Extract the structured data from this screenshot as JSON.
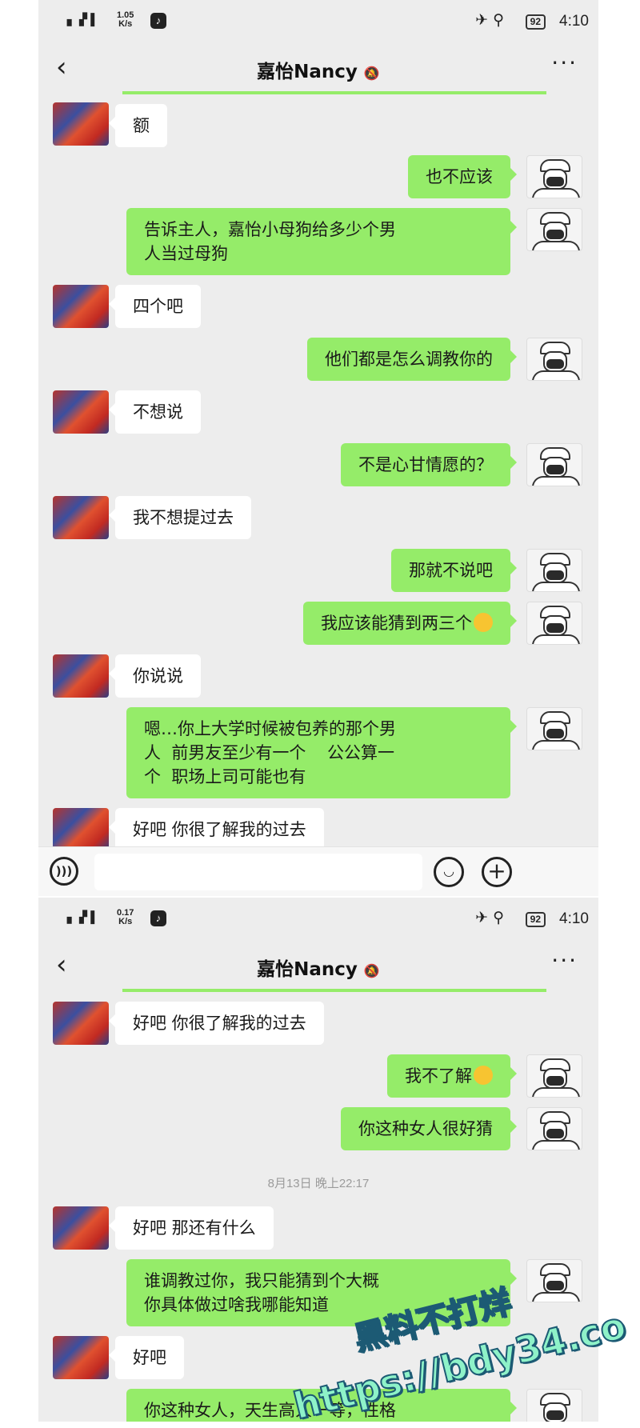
{
  "screens": [
    {
      "status": {
        "signal": "5G",
        "net_speed": "1.05",
        "net_unit": "K/s",
        "battery": "92",
        "time": "4:10"
      },
      "nav": {
        "title": "嘉怡Nancy"
      },
      "messages": [
        {
          "dir": "in",
          "text": "额"
        },
        {
          "dir": "out",
          "text": "也不应该"
        },
        {
          "dir": "out",
          "text": "告诉主人，嘉怡小母狗给多少个男\n人当过母狗"
        },
        {
          "dir": "in",
          "text": "四个吧"
        },
        {
          "dir": "out",
          "text": "他们都是怎么调教你的"
        },
        {
          "dir": "in",
          "text": "不想说"
        },
        {
          "dir": "out",
          "text": "不是心甘情愿的？"
        },
        {
          "dir": "in",
          "text": "我不想提过去"
        },
        {
          "dir": "out",
          "text": "那就不说吧"
        },
        {
          "dir": "out",
          "text": "我应该能猜到两三个",
          "emoji": "thinking-emoji"
        },
        {
          "dir": "in",
          "text": "你说说"
        },
        {
          "dir": "out",
          "text": "嗯…你上大学时候被包养的那个男\n人  前男友至少有一个    公公算一\n个  职场上司可能也有"
        },
        {
          "dir": "in",
          "text": "好吧 你很了解我的过去"
        }
      ]
    },
    {
      "status": {
        "signal": "5G",
        "net_speed": "0.17",
        "net_unit": "K/s",
        "battery": "92",
        "time": "4:10"
      },
      "nav": {
        "title": "嘉怡Nancy"
      },
      "messages": [
        {
          "dir": "in",
          "text": "好吧 你很了解我的过去"
        },
        {
          "dir": "out",
          "text": "我不了解",
          "emoji": "thinking-emoji"
        },
        {
          "dir": "out",
          "text": "你这种女人很好猜"
        },
        {
          "dir": "time",
          "text": "8月13日 晚上22:17"
        },
        {
          "dir": "in",
          "text": "好吧 那还有什么"
        },
        {
          "dir": "out",
          "text": "谁调教过你，我只能猜到个大概\n你具体做过啥我哪能知道"
        },
        {
          "dir": "in",
          "text": "好吧"
        },
        {
          "dir": "out",
          "text": "你这种女人，天生高人一等，性格"
        }
      ]
    }
  ],
  "watermark": {
    "line1": "黑料不打烊",
    "line2": "https://bdy34.co"
  },
  "colors": {
    "out_bubble": "#95ec69",
    "in_bubble": "#ffffff",
    "chat_bg": "#ededed"
  }
}
